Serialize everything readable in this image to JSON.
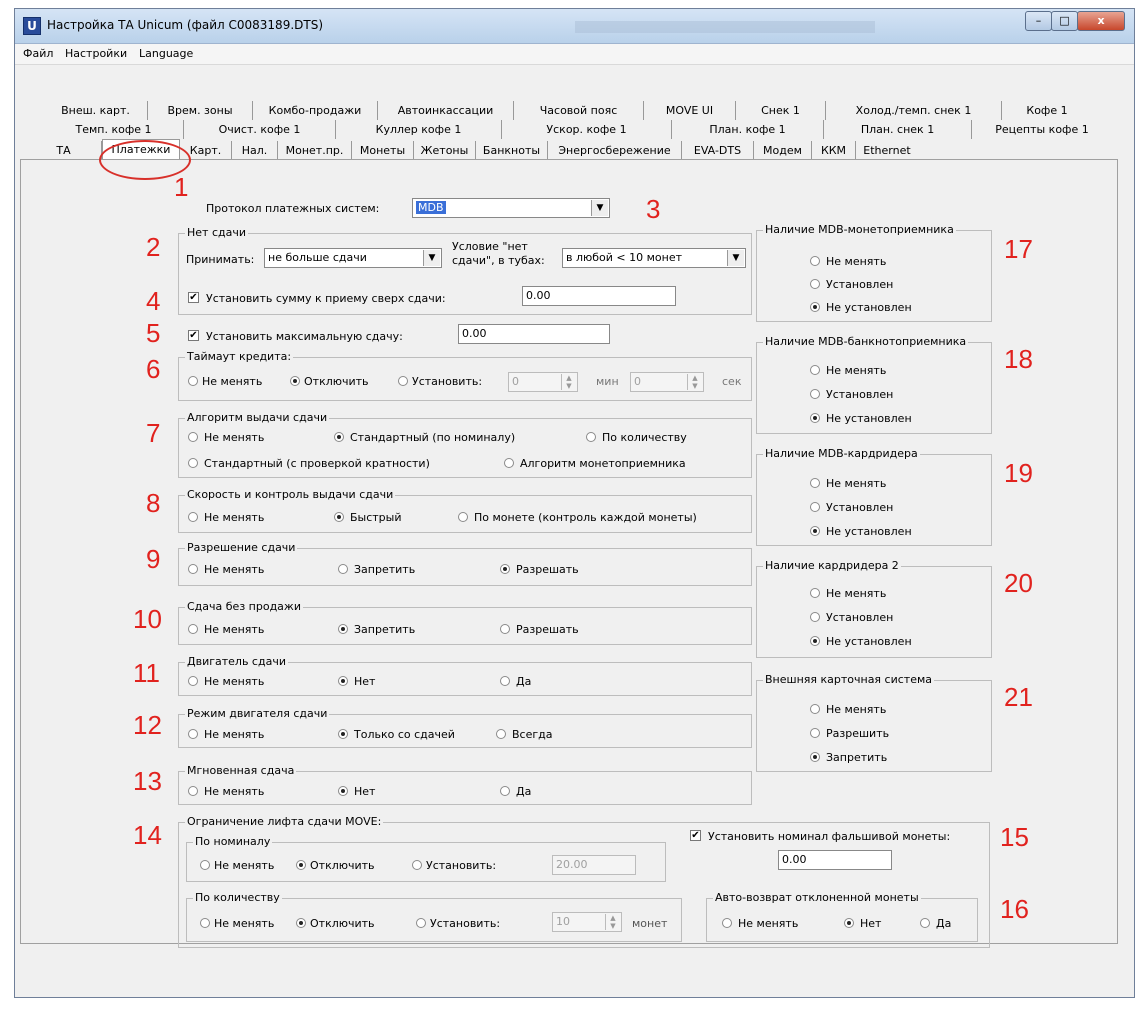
{
  "window": {
    "title": "Настройка ТА Unicum (файл C0083189.DTS)",
    "app_icon": "U",
    "minimize": "–",
    "maximize": "□",
    "close": "x"
  },
  "menu": [
    "Файл",
    "Настройки",
    "Language"
  ],
  "tabs": {
    "row1": [
      "Внеш. карт.",
      "Врем. зоны",
      "Комбо-продажи",
      "Автоинкассации",
      "Часовой пояс",
      "MOVE UI",
      "Снек 1",
      "Холод./темп. снек 1",
      "Кофе 1"
    ],
    "row2": [
      "Темп. кофе 1",
      "Очист. кофе 1",
      "Куллер кофе 1",
      "Ускор. кофе 1",
      "План. кофе 1",
      "План. снек 1",
      "Рецепты кофе 1"
    ],
    "row3": [
      "ТА",
      "Платежки",
      "Карт.",
      "Нал.",
      "Монет.пр.",
      "Монеты",
      "Жетоны",
      "Банкноты",
      "Энергосбережение",
      "EVA-DTS",
      "Модем",
      "ККМ",
      "Ethernet"
    ],
    "active": "Платежки"
  },
  "protocol": {
    "label": "Протокол платежных систем:",
    "value": "MDB"
  },
  "no_change": {
    "title": "Нет сдачи",
    "accept_label": "Принимать:",
    "accept_value": "не больше сдачи",
    "condition_label_1": "Условие \"нет",
    "condition_label_2": "сдачи\", в тубах:",
    "condition_value": "в любой < 10 монет"
  },
  "extra_sum": {
    "label": "Установить сумму к приему сверх сдачи:",
    "value": "0.00",
    "checked": true
  },
  "max_change": {
    "label": "Установить максимальную сдачу:",
    "value": "0.00",
    "checked": true
  },
  "credit_timeout": {
    "title": "Таймаут кредита:",
    "options": [
      "Не менять",
      "Отключить",
      "Установить:"
    ],
    "selected": 1,
    "min_value": "0",
    "min_label": "мин",
    "sec_value": "0",
    "sec_label": "сек"
  },
  "change_algorithm": {
    "title": "Алгоритм выдачи сдачи",
    "options": [
      "Не менять",
      "Стандартный (по номиналу)",
      "По количеству",
      "Стандартный (с проверкой кратности)",
      "Алгоритм монетоприемника"
    ],
    "selected": 1
  },
  "change_speed": {
    "title": "Скорость и контроль выдачи сдачи",
    "options": [
      "Не менять",
      "Быстрый",
      "По монете (контроль каждой монеты)"
    ],
    "selected": 1
  },
  "change_permission": {
    "title": "Разрешение сдачи",
    "options": [
      "Не менять",
      "Запретить",
      "Разрешать"
    ],
    "selected": 2
  },
  "change_no_sale": {
    "title": "Сдача без продажи",
    "options": [
      "Не менять",
      "Запретить",
      "Разрешать"
    ],
    "selected": 1
  },
  "change_motor": {
    "title": "Двигатель сдачи",
    "options": [
      "Не менять",
      "Нет",
      "Да"
    ],
    "selected": 1
  },
  "motor_mode": {
    "title": "Режим двигателя сдачи",
    "options": [
      "Не менять",
      "Только со сдачей",
      "Всегда"
    ],
    "selected": 1
  },
  "instant_change": {
    "title": "Мгновенная сдача",
    "options": [
      "Не менять",
      "Нет",
      "Да"
    ],
    "selected": 1
  },
  "move_limit": {
    "title": "Ограничение лифта сдачи MOVE:",
    "by_nominal": {
      "title": "По номиналу",
      "options": [
        "Не менять",
        "Отключить",
        "Установить:"
      ],
      "selected": 1,
      "value": "20.00"
    },
    "by_count": {
      "title": "По количеству",
      "options": [
        "Не менять",
        "Отключить",
        "Установить:"
      ],
      "selected": 1,
      "value": "10",
      "unit": "монет"
    }
  },
  "fake_coin": {
    "label": "Установить номинал фальшивой монеты:",
    "value": "0.00",
    "checked": true
  },
  "auto_return": {
    "title": "Авто-возврат отклоненной монеты",
    "options": [
      "Не менять",
      "Нет",
      "Да"
    ],
    "selected": 1
  },
  "mdb_coin": {
    "title": "Наличие MDB-монетоприемника",
    "options": [
      "Не менять",
      "Установлен",
      "Не установлен"
    ],
    "selected": 2
  },
  "mdb_bill": {
    "title": "Наличие MDB-банкнотоприемника",
    "options": [
      "Не менять",
      "Установлен",
      "Не установлен"
    ],
    "selected": 2
  },
  "mdb_card": {
    "title": "Наличие MDB-кардридера",
    "options": [
      "Не менять",
      "Установлен",
      "Не установлен"
    ],
    "selected": 2
  },
  "card2": {
    "title": "Наличие кардридера 2",
    "options": [
      "Не менять",
      "Установлен",
      "Не установлен"
    ],
    "selected": 2
  },
  "ext_card": {
    "title": "Внешняя карточная система",
    "options": [
      "Не менять",
      "Разрешить",
      "Запретить"
    ],
    "selected": 2
  },
  "annotations": [
    "1",
    "2",
    "3",
    "4",
    "5",
    "6",
    "7",
    "8",
    "9",
    "10",
    "11",
    "12",
    "13",
    "14",
    "15",
    "16",
    "17",
    "18",
    "19",
    "20",
    "21"
  ],
  "colors": {
    "annotation": "#e1221e",
    "protocol_highlight": "#3a6fd8"
  }
}
